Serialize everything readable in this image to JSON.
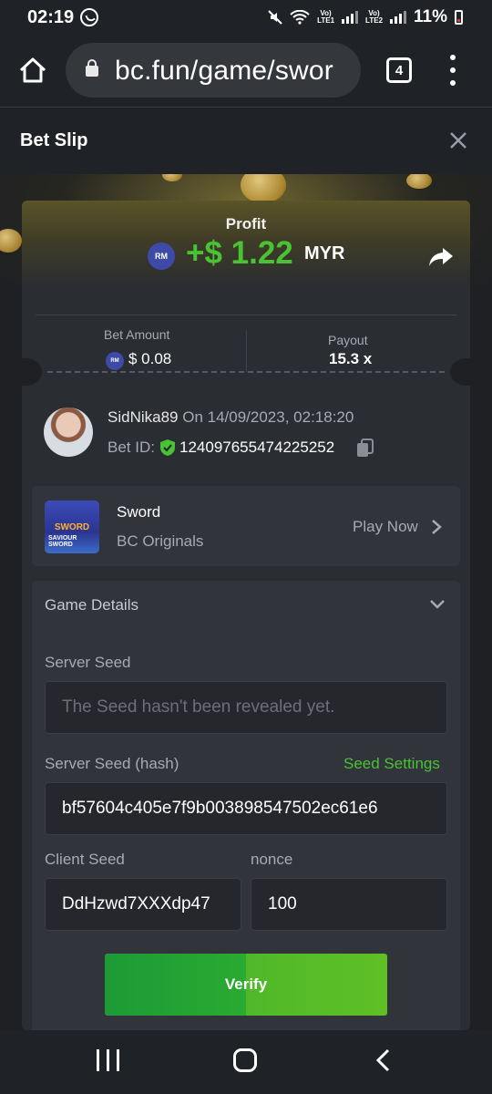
{
  "status_bar": {
    "time": "02:19",
    "battery": "11%"
  },
  "browser": {
    "url": "bc.fun/game/swor",
    "tab_count": "4"
  },
  "header": {
    "title": "Bet Slip"
  },
  "profit": {
    "label": "Profit",
    "currency_badge": "RM",
    "value": "+$ 1.22",
    "currency": "MYR"
  },
  "bet": {
    "amount_label": "Bet Amount",
    "currency_badge": "RM",
    "amount": "$ 0.08",
    "payout_label": "Payout",
    "payout": "15.3 x"
  },
  "user": {
    "name": "SidNika89",
    "date": "On 14/09/2023, 02:18:20",
    "bet_id_label": "Bet ID:",
    "bet_id": "124097655474225252"
  },
  "game": {
    "name": "Sword",
    "provider": "BC Originals",
    "play_now": "Play Now",
    "thumb_top": "SWORD",
    "thumb_bottom": "SAVIOUR SWORD"
  },
  "details": {
    "title": "Game Details",
    "server_seed_label": "Server Seed",
    "server_seed_placeholder": "The Seed hasn't been revealed yet.",
    "server_seed_hash_label": "Server Seed (hash)",
    "seed_settings": "Seed Settings",
    "server_seed_hash": "bf57604c405e7f9b003898547502ec61e6",
    "client_seed_label": "Client Seed",
    "client_seed": "DdHzwd7XXXdp47",
    "nonce_label": "nonce",
    "nonce": "100",
    "verify": "Verify"
  },
  "colors": {
    "accent_green": "#49c233",
    "badge_blue": "#3d4aa6",
    "background": "#1e2023"
  },
  "icons": [
    "whatsapp-icon",
    "home-icon",
    "lock-icon",
    "tabs-icon",
    "menu-icon",
    "close-icon",
    "share-icon",
    "shield-icon",
    "copy-icon",
    "chevron-right-icon",
    "chevron-down-icon",
    "recent-apps-icon",
    "home-nav-icon",
    "back-icon"
  ]
}
